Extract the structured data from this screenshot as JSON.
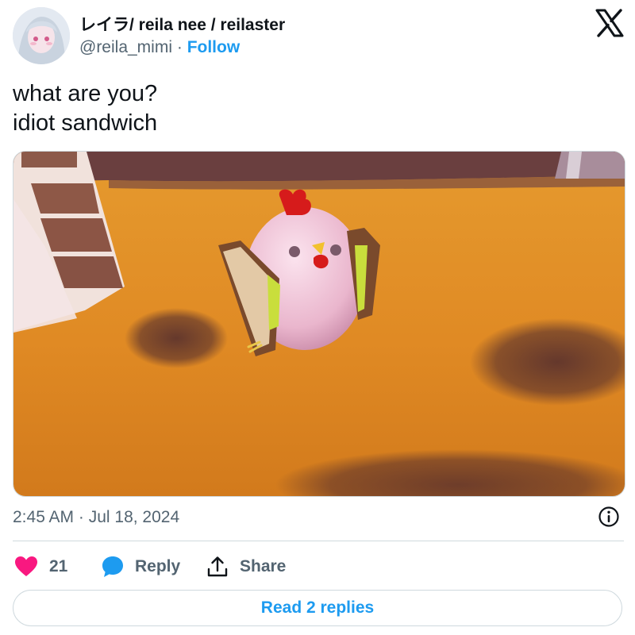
{
  "author": {
    "display_name": "レイラ/ reila nee / reilaster",
    "handle": "@reila_mimi",
    "separator": "·",
    "follow_label": "Follow"
  },
  "tweet": {
    "lines": [
      "what are you?",
      "idiot sandwich"
    ],
    "timestamp": "2:45 AM · Jul 18, 2024"
  },
  "actions": {
    "like_count": "21",
    "reply_label": "Reply",
    "share_label": "Share"
  },
  "read_replies_label": "Read 2 replies",
  "icons": {
    "platform_logo": "x-logo-icon",
    "info": "info-icon",
    "like": "heart-icon",
    "reply": "speech-bubble-icon",
    "share": "share-arrow-icon"
  },
  "colors": {
    "accent": "#1d9bf0",
    "like": "#f91880",
    "secondary_text": "#536471"
  }
}
